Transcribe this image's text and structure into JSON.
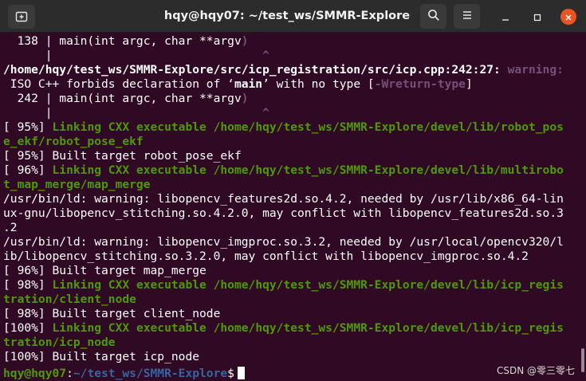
{
  "window": {
    "title": "hqy@hqy07: ~/test_ws/SMMR-Explore"
  },
  "icons": {
    "new_tab": "new-tab-icon",
    "search": "search-icon",
    "menu": "hamburger-menu-icon",
    "minimize": "minimize-icon",
    "maximize": "maximize-icon",
    "close": "close-icon"
  },
  "colors": {
    "terminal_bg": "#300a24",
    "green": "#4e9a06",
    "magenta": "#75507b",
    "blue": "#3465a4",
    "close_orange": "#e95420"
  },
  "terminal": {
    "lines": [
      [
        {
          "t": "  138 | main(int argc, char **argv",
          "c": "w"
        },
        {
          "t": ")",
          "c": "m"
        }
      ],
      [
        {
          "t": "      |                              ",
          "c": "w"
        },
        {
          "t": "^",
          "c": "m"
        }
      ],
      [
        {
          "t": "/home/hqy/test_ws/SMMR-Explore/src/icp_registration/src/icp.cpp:242:27: ",
          "c": "b"
        },
        {
          "t": "warning:",
          "c": "m"
        }
      ],
      [
        {
          "t": " ISO C++ forbids declaration of ‘",
          "c": "w"
        },
        {
          "t": "main",
          "c": "b"
        },
        {
          "t": "’ with no type [",
          "c": "w"
        },
        {
          "t": "-Wreturn-type",
          "c": "m"
        },
        {
          "t": "]",
          "c": "w"
        }
      ],
      [
        {
          "t": "  242 | main(int argc, char **argv",
          "c": "w"
        },
        {
          "t": ")",
          "c": "m"
        }
      ],
      [
        {
          "t": "      |                              ",
          "c": "w"
        },
        {
          "t": "^",
          "c": "m"
        }
      ],
      [
        {
          "t": "[ 95%] ",
          "c": "w"
        },
        {
          "t": "Linking CXX executable /home/hqy/test_ws/SMMR-Explore/devel/lib/robot_pos",
          "c": "g"
        }
      ],
      [
        {
          "t": "e_ekf/robot_pose_ekf",
          "c": "g"
        }
      ],
      [
        {
          "t": "[ 95%] Built target robot_pose_ekf",
          "c": "w"
        }
      ],
      [
        {
          "t": "[ 96%] ",
          "c": "w"
        },
        {
          "t": "Linking CXX executable /home/hqy/test_ws/SMMR-Explore/devel/lib/multirobo",
          "c": "g"
        }
      ],
      [
        {
          "t": "t_map_merge/map_merge",
          "c": "g"
        }
      ],
      [
        {
          "t": "/usr/bin/ld: warning: libopencv_features2d.so.4.2, needed by /usr/lib/x86_64-lin",
          "c": "w"
        }
      ],
      [
        {
          "t": "ux-gnu/libopencv_stitching.so.4.2.0, may conflict with libopencv_features2d.so.3",
          "c": "w"
        }
      ],
      [
        {
          "t": ".2",
          "c": "w"
        }
      ],
      [
        {
          "t": "/usr/bin/ld: warning: libopencv_imgproc.so.3.2, needed by /usr/local/opencv320/l",
          "c": "w"
        }
      ],
      [
        {
          "t": "ib/libopencv_stitching.so.3.2.0, may conflict with libopencv_imgproc.so.4.2",
          "c": "w"
        }
      ],
      [
        {
          "t": "[ 96%] Built target map_merge",
          "c": "w"
        }
      ],
      [
        {
          "t": "[ 98%] ",
          "c": "w"
        },
        {
          "t": "Linking CXX executable /home/hqy/test_ws/SMMR-Explore/devel/lib/icp_regis",
          "c": "g"
        }
      ],
      [
        {
          "t": "tration/client_node",
          "c": "g"
        }
      ],
      [
        {
          "t": "[ 98%] Built target client_node",
          "c": "w"
        }
      ],
      [
        {
          "t": "[100%] ",
          "c": "w"
        },
        {
          "t": "Linking CXX executable /home/hqy/test_ws/SMMR-Explore/devel/lib/icp_regis",
          "c": "g"
        }
      ],
      [
        {
          "t": "tration/icp_node",
          "c": "g"
        }
      ],
      [
        {
          "t": "[100%] Built target icp_node",
          "c": "w"
        }
      ]
    ],
    "prompt": {
      "user_host": "hqy@hqy07",
      "separator": ":",
      "path": "~/test_ws/SMMR-Explore",
      "symbol": "$"
    }
  },
  "watermark": "CSDN @零三零七"
}
